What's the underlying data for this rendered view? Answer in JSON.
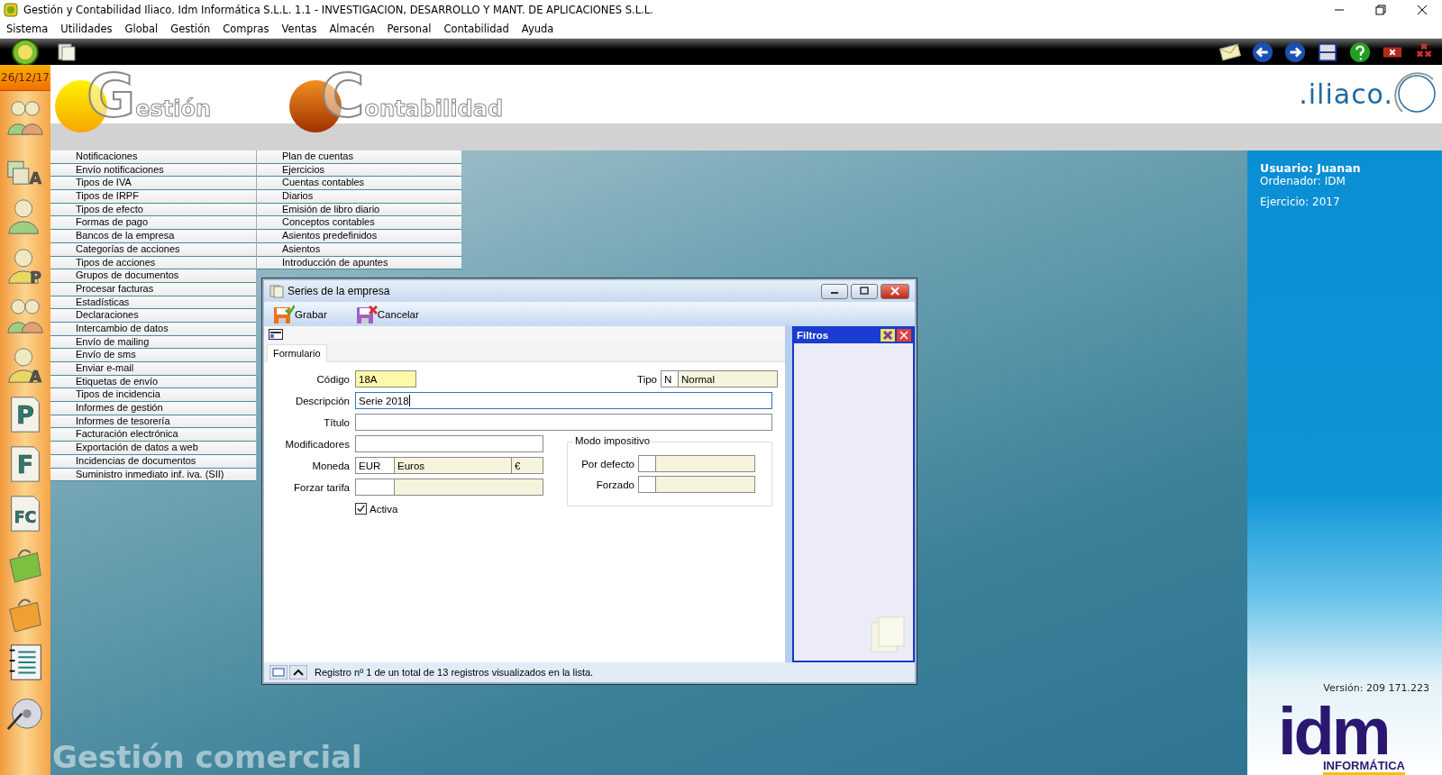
{
  "window": {
    "title": "Gestión y Contabilidad Iliaco. Idm Informática S.L.L. 1.1 - INVESTIGACION, DESARROLLO Y MANT. DE APLICACIONES S.L.L."
  },
  "menu": [
    "Sistema",
    "Utilidades",
    "Global",
    "Gestión",
    "Compras",
    "Ventas",
    "Almacén",
    "Personal",
    "Contabilidad",
    "Ayuda"
  ],
  "date": "26/12/17",
  "sidebar_icons": [
    {
      "kind": "people"
    },
    {
      "kind": "blocks",
      "letter": "A"
    },
    {
      "kind": "person"
    },
    {
      "kind": "person",
      "letter": "P"
    },
    {
      "kind": "people"
    },
    {
      "kind": "person",
      "letter": "A"
    },
    {
      "kind": "doc",
      "letter": "P"
    },
    {
      "kind": "doc",
      "letter": "F"
    },
    {
      "kind": "doc",
      "letter": "FC"
    },
    {
      "kind": "bag",
      "color": "#7cc040"
    },
    {
      "kind": "bag",
      "color": "#f0a030"
    },
    {
      "kind": "notebook"
    },
    {
      "kind": "disc"
    }
  ],
  "logos": [
    {
      "initial": "G",
      "rest": "estión"
    },
    {
      "initial": "C",
      "rest": "ontabilidad"
    }
  ],
  "brand": ".iliaco.",
  "menu_columns": [
    [
      "Notificaciones",
      "Envío notificaciones",
      "Tipos de IVA",
      "Tipos de IRPF",
      "Tipos de efecto",
      "Formas de pago",
      "Bancos de la empresa",
      "Categorías de acciones",
      "Tipos de acciones",
      "Grupos de documentos",
      "Procesar facturas",
      "Estadísticas",
      "Declaraciones",
      "Intercambio de datos",
      "Envío de mailing",
      "Envío de sms",
      "Enviar e-mail",
      "Etiquetas de envío",
      "Tipos de incidencia",
      "Informes de gestión",
      "Informes de tesorería",
      "Facturación electrónica",
      "Exportación de datos a web",
      "Incidencias de documentos",
      "Suministro inmediato inf. iva. (SII)"
    ],
    [
      "Plan de cuentas",
      "Ejercicios",
      "Cuentas contables",
      "Diarios",
      "Emisión de libro diario",
      "Conceptos contables",
      "Asientos predefinidos",
      "Asientos",
      "Introducción de apuntes"
    ]
  ],
  "dialog": {
    "title": "Series de la empresa",
    "tools": [
      {
        "kind": "save",
        "label": "Grabar"
      },
      {
        "kind": "cancel",
        "label": "Cancelar"
      }
    ],
    "tabs": [
      {
        "label": "Formulario",
        "selected": true
      }
    ],
    "codigo": {
      "label": "Código",
      "value": "18A"
    },
    "tipo": {
      "label": "Tipo",
      "code": "N",
      "name": "Normal"
    },
    "descripcion": {
      "label": "Descripción",
      "value": "Serie 2018",
      "focused": true
    },
    "titulo": {
      "label": "Título"
    },
    "modificadores": {
      "label": "Modificadores"
    },
    "moneda": {
      "label": "Moneda",
      "code": "EUR",
      "name": "Euros",
      "symbol": "€"
    },
    "forzar_tarifa": {
      "label": "Forzar tarifa"
    },
    "activa": {
      "label": "Activa",
      "checked": true
    },
    "modo_impositivo": {
      "title": "Modo impositivo",
      "fields": [
        {
          "label": "Por defecto"
        },
        {
          "label": "Forzado"
        }
      ]
    },
    "filters": {
      "title": "Filtros"
    },
    "status": "Registro nº 1 de un total de 13 registros visualizados en la lista."
  },
  "info": {
    "user": "Usuario: Juanan",
    "computer": "Ordenador: IDM",
    "year": "Ejercicio: 2017",
    "version": "Versión: 209 171.223"
  },
  "footer_brand": {
    "mark": "idm",
    "sub": "INFORMÁTICA"
  },
  "watermark": "Gestión comercial"
}
